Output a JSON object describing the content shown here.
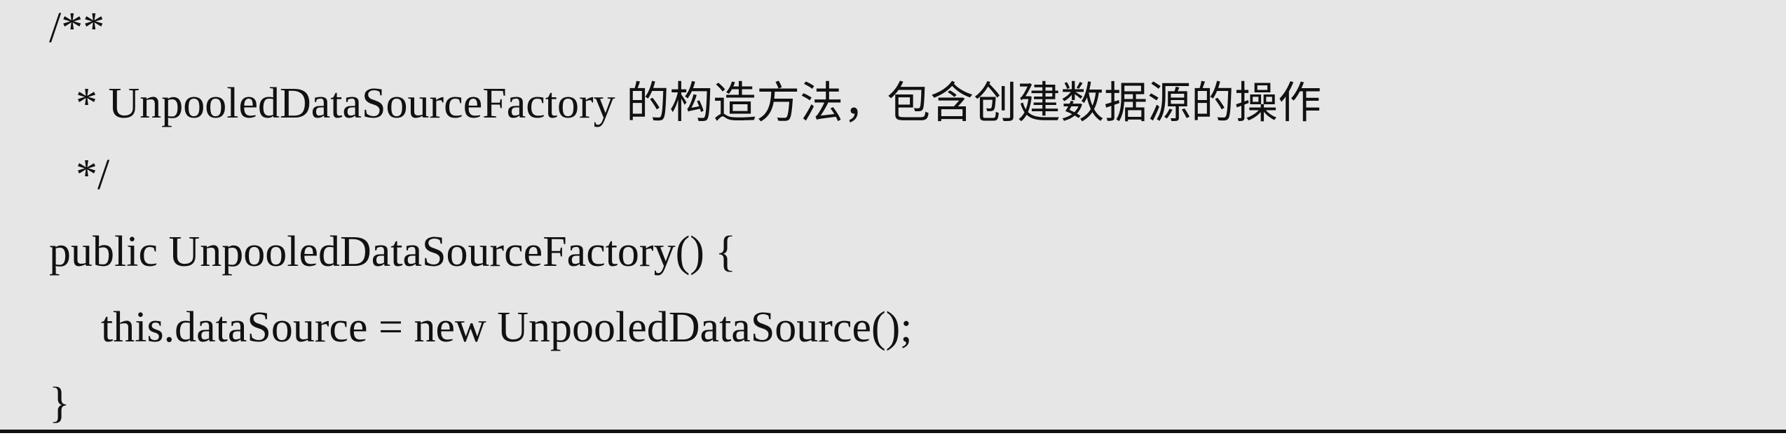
{
  "code_block": {
    "lines": [
      "/**",
      "* UnpooledDataSourceFactory 的构造方法，包含创建数据源的操作",
      "*/",
      "public UnpooledDataSourceFactory() {",
      "this.dataSource = new UnpooledDataSource();",
      "}"
    ]
  },
  "colors": {
    "background": "#e6e6e6",
    "text": "#111111",
    "rule": "#111111"
  }
}
